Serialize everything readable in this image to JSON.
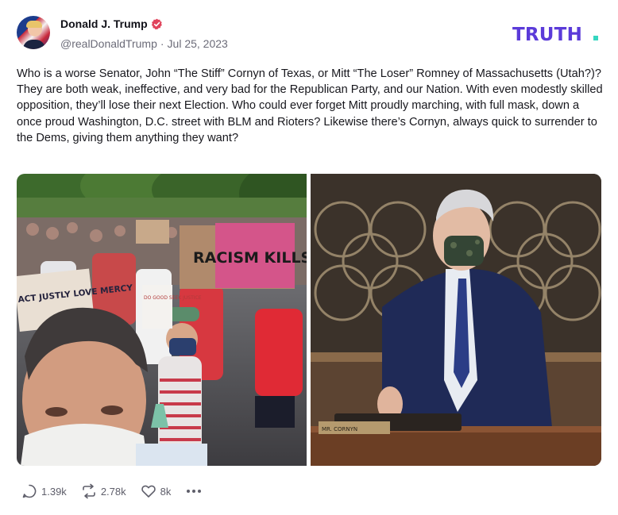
{
  "author": {
    "display_name": "Donald J. Trump",
    "handle": "@realDonaldTrump",
    "separator": "·",
    "date": "Jul 25, 2023",
    "verified": true,
    "verified_color": "#e0435b"
  },
  "brand": {
    "logo_text": "TRUTH.",
    "logo_color": "#5b3bd9",
    "logo_dot_color": "#36d6c0"
  },
  "post": {
    "text": "Who is a worse Senator, John “The Stiff” Cornyn of Texas, or Mitt “The Loser” Romney of Massachusetts (Utah?)? They are both weak, ineffective, and very bad for the Republican Party, and our Nation. With even modestly skilled opposition, they’ll lose their next Election. Who could ever forget Mitt proudly marching, with full mask, down a once proud Washington, D.C. street with BLM and Rioters? Likewise there’s Cornyn, always quick to surrender to the Dems, giving them anything they want?"
  },
  "media": {
    "left_photo": {
      "signs": [
        "RACISM KILLS",
        "ACT JUSTLY LOVE MERCY",
        "DO GOOD SEEK JUSTICE"
      ]
    },
    "right_photo": {
      "nameplate": "MR. CORNYN"
    }
  },
  "actions": {
    "reply_count": "1.39k",
    "retruth_count": "2.78k",
    "like_count": "8k",
    "icons": [
      "reply-icon",
      "retruth-icon",
      "heart-icon",
      "more-icon"
    ]
  }
}
